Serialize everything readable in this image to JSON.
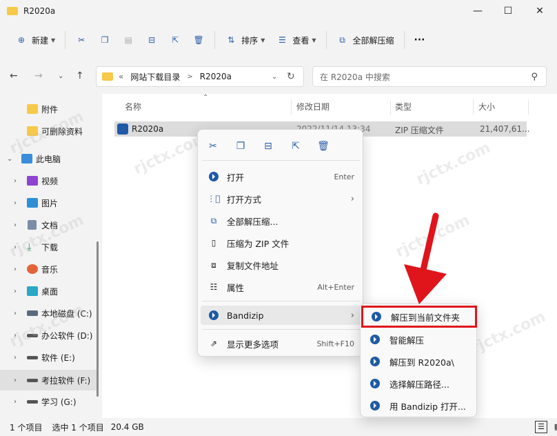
{
  "window": {
    "title": "R2020a"
  },
  "toolbar": {
    "new_label": "新建",
    "sort_label": "排序",
    "view_label": "查看",
    "extract_all_label": "全部解压缩",
    "more_label": "···"
  },
  "address": {
    "prefix": "«",
    "crumbs": [
      "网站下载目录",
      "R2020a"
    ],
    "chevron": ">"
  },
  "search": {
    "placeholder": "在 R2020a 中搜索"
  },
  "sidebar": {
    "items": [
      {
        "label": "附件"
      },
      {
        "label": "可删除资料"
      },
      {
        "label": "此电脑"
      },
      {
        "label": "视频"
      },
      {
        "label": "图片"
      },
      {
        "label": "文档"
      },
      {
        "label": "下载"
      },
      {
        "label": "音乐"
      },
      {
        "label": "桌面"
      },
      {
        "label": "本地磁盘 (C:)"
      },
      {
        "label": "办公软件 (D:)"
      },
      {
        "label": "软件 (E:)"
      },
      {
        "label": "考拉软件 (F:)"
      },
      {
        "label": "学习 (G:)"
      }
    ]
  },
  "columns": {
    "name": "名称",
    "modified": "修改日期",
    "type": "类型",
    "size": "大小"
  },
  "file": {
    "name": "R2020a",
    "modified": "2022/11/14 13:34",
    "type": "ZIP 压缩文件",
    "size": "21,407,61..."
  },
  "context_menu": {
    "open": "打开",
    "open_shortcut": "Enter",
    "open_with": "打开方式",
    "extract_all": "全部解压缩...",
    "compress_zip": "压缩为 ZIP 文件",
    "copy_path": "复制文件地址",
    "properties": "属性",
    "properties_shortcut": "Alt+Enter",
    "bandizip": "Bandizip",
    "more_options": "显示更多选项",
    "more_options_shortcut": "Shift+F10"
  },
  "submenu": {
    "items": [
      {
        "label": "解压到当前文件夹"
      },
      {
        "label": "智能解压"
      },
      {
        "label": "解压到 R2020a\\"
      },
      {
        "label": "选择解压路径..."
      },
      {
        "label": "用 Bandizip 打开..."
      }
    ]
  },
  "status": {
    "count": "1 个项目",
    "selected": "选中 1 个项目",
    "size": "20.4 GB"
  },
  "watermark": "rjctx.com",
  "colors": {
    "accent": "#2b5ea7",
    "highlight_box": "#e0141b",
    "arrow": "#e0141b"
  }
}
